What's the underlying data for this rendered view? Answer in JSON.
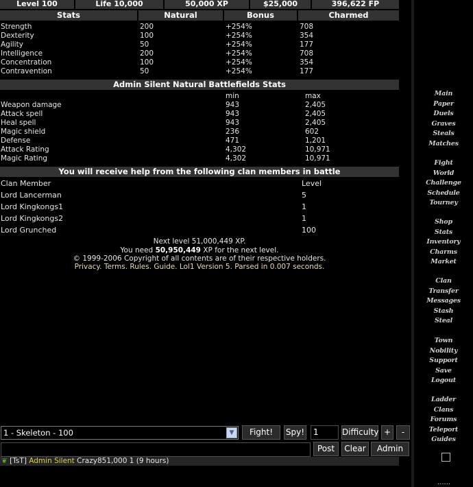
{
  "top_stats": [
    "Level 100",
    "Life 10,000",
    "50,000 XP",
    "$25,000",
    "396,622 FP"
  ],
  "stats": {
    "headers": [
      "Stats",
      "Natural",
      "Bonus",
      "Charmed"
    ],
    "rows": [
      [
        "Strength",
        "200",
        "+254%",
        "708"
      ],
      [
        "Dexterity",
        "100",
        "+254%",
        "354"
      ],
      [
        "Agility",
        "50",
        "+254%",
        "177"
      ],
      [
        "Intelligence",
        "200",
        "+254%",
        "708"
      ],
      [
        "Concentration",
        "100",
        "+254%",
        "354"
      ],
      [
        "Contravention",
        "50",
        "+254%",
        "177"
      ]
    ]
  },
  "battlefield": {
    "title": "Admin Silent Natural Battlefields Stats",
    "min_label": "min",
    "max_label": "max",
    "rows": [
      [
        "Weapon damage",
        "943",
        "2,405"
      ],
      [
        "Attack spell",
        "943",
        "2,405"
      ],
      [
        "Heal spell",
        "943",
        "2,405"
      ],
      [
        "Magic shield",
        "236",
        "602"
      ],
      [
        "Defense",
        "471",
        "1,201"
      ],
      [
        "Attack Rating",
        "4,302",
        "10,971"
      ],
      [
        "Magic Rating",
        "4,302",
        "10,971"
      ]
    ]
  },
  "clan": {
    "title": "You will receive help from the following clan members in battle",
    "col_member": "Clan Member",
    "col_level": "Level",
    "members": [
      [
        "Lord Lancerman",
        "5"
      ],
      [
        "Lord Kingkongs1",
        "1"
      ],
      [
        "Lord Kingkongs2",
        "1"
      ],
      [
        "Lord Grunched",
        "100"
      ]
    ]
  },
  "footer": {
    "next_level": "Next level 51,000,449 XP.",
    "need_prefix": "You need",
    "need_amount": "50,950,449",
    "need_suffix": "XP for the next level.",
    "copyright": "© 1999-2006 Copyright of all contents are of their respective holders.",
    "links": "Privacy. Terms. Rules. Guide. Lol1 Version 5. Parsed in 0.007 seconds."
  },
  "controls": {
    "monster_select": "1 - Skeleton - 100",
    "fight": "Fight!",
    "spy": "Spy!",
    "count_value": "1",
    "difficulty": "Difficulty",
    "plus": "+",
    "minus": "-",
    "post": "Post",
    "clear": "Clear",
    "admin": "Admin"
  },
  "chat": {
    "tag": "[TsT]",
    "name": "Admin Silent",
    "message": "Crazy851,000 1 (9 hours)"
  },
  "sidebar": {
    "groups": [
      [
        "Main",
        "Paper",
        "Duels",
        "Graves",
        "Steals",
        "Matches"
      ],
      [
        "Fight",
        "World",
        "Challenge",
        "Schedule",
        "Tourney"
      ],
      [
        "Shop",
        "Stats",
        "Inventory",
        "Charms",
        "Market"
      ],
      [
        "Clan",
        "Transfer",
        "Messages",
        "Stash",
        "Steal"
      ],
      [
        "Town",
        "Nobility",
        "Support",
        "Save",
        "Logout"
      ],
      [
        "Ladder",
        "Clans",
        "Forums",
        "Teleport",
        "Guides"
      ]
    ],
    "dots": "......"
  }
}
